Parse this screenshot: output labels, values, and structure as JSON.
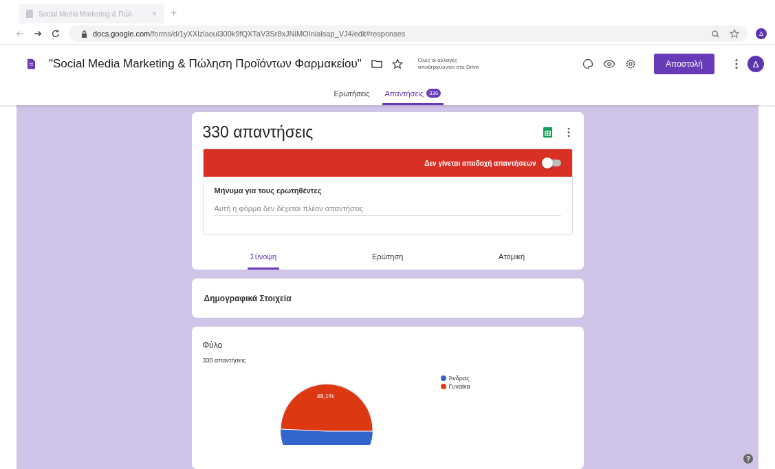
{
  "browser": {
    "tab_title": "Social Media Marketing & Πώλ",
    "tab_close": "×",
    "new_tab": "+",
    "url_host": "docs.google.com",
    "url_path": "/forms/d/1yXXizlaoul300k9fQXTaV3Sr8xJNiMOInialsap_VJ4/edit#responses",
    "avatar": "Δ"
  },
  "header": {
    "title": "\"Social Media Marketing & Πώληση Προϊόντων Φαρμακείου\"",
    "save_status": [
      "Όλες οι αλλαγές",
      "αποθηκεύονται στο Drive"
    ],
    "send_button": "Αποστολή",
    "avatar": "Δ"
  },
  "tabs": [
    {
      "label": "Ερωτήσεις",
      "selected": false
    },
    {
      "label": "Απαντήσεις",
      "selected": true,
      "badge": "330"
    }
  ],
  "summary": {
    "title": "330 απαντήσεις",
    "banner": "Δεν γίνεται αποδοχή απαντήσεων",
    "accepting": false,
    "message_label": "Μήνυμα για τους ερωτηθέντες",
    "message_placeholder": "Αυτή η φόρμα δεν δέχεται πλέον απαντήσεις"
  },
  "view_tabs": [
    {
      "label": "Σύνοψη",
      "selected": true
    },
    {
      "label": "Ερώτηση",
      "selected": false
    },
    {
      "label": "Ατομική",
      "selected": false
    }
  ],
  "section": {
    "title": "Δημογραφικά Στοιχεία"
  },
  "question": {
    "title": "Φύλο",
    "count": "330 απαντήσεις",
    "slice_label": "49,1%",
    "legend": [
      {
        "label": "Άνδρας",
        "color": "#3366cc"
      },
      {
        "label": "Γυναίκα",
        "color": "#dc3912"
      }
    ]
  },
  "help": "?"
}
